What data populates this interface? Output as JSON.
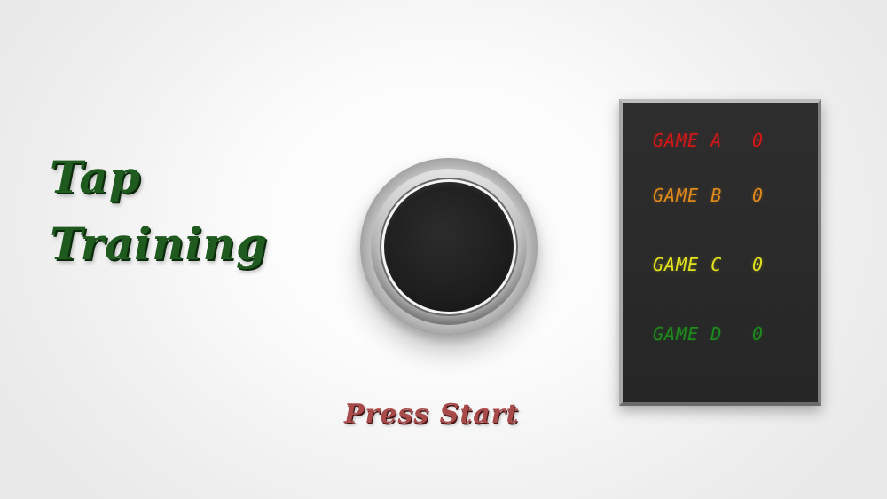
{
  "title": {
    "line1": "Tap",
    "line2": "Training"
  },
  "start_prompt": "Press Start",
  "scoreboard": {
    "rows": [
      {
        "label": "GAME A",
        "score": "0",
        "color": "#d01818"
      },
      {
        "label": "GAME B",
        "score": "0",
        "color": "#e08a1c"
      },
      {
        "label": "GAME C",
        "score": "0",
        "color": "#e2e21f"
      },
      {
        "label": "GAME D",
        "score": "0",
        "color": "#1e8a1e"
      }
    ]
  },
  "colors": {
    "title": "#1f5a1f",
    "start_prompt": "#a94a4a",
    "panel": "#262626"
  },
  "icons": {
    "main_button": "round-push-button-icon"
  }
}
